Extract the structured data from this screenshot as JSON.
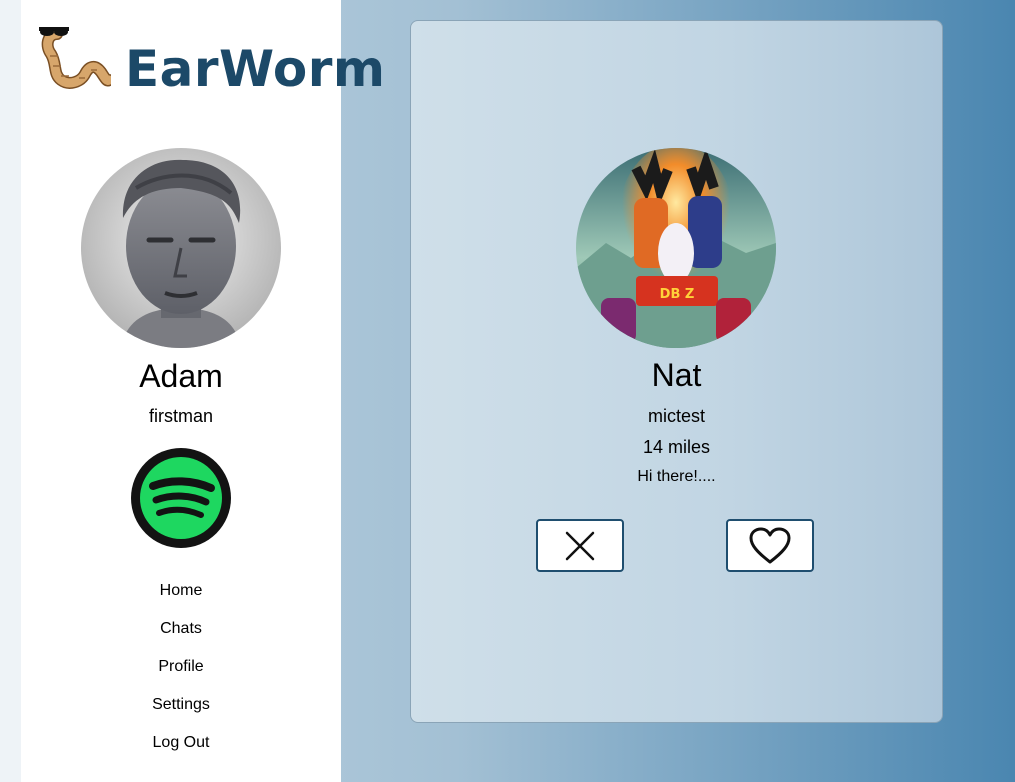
{
  "brand": {
    "name": "EarWorm"
  },
  "user": {
    "name": "Adam",
    "username": "firstman"
  },
  "sidebar": {
    "spotify_icon": "spotify-icon",
    "nav": [
      {
        "label": "Home"
      },
      {
        "label": "Chats"
      },
      {
        "label": "Profile"
      },
      {
        "label": "Settings"
      },
      {
        "label": "Log Out"
      }
    ]
  },
  "match": {
    "name": "Nat",
    "username": "mictest",
    "distance": "14 miles",
    "bio": "Hi there!....",
    "actions": {
      "reject_icon": "close-icon",
      "like_icon": "heart-icon"
    }
  },
  "colors": {
    "brand_text": "#1c4968",
    "button_border": "#1f4e6f",
    "spotify_green": "#1ed760",
    "background_right": "#4a86b0"
  }
}
